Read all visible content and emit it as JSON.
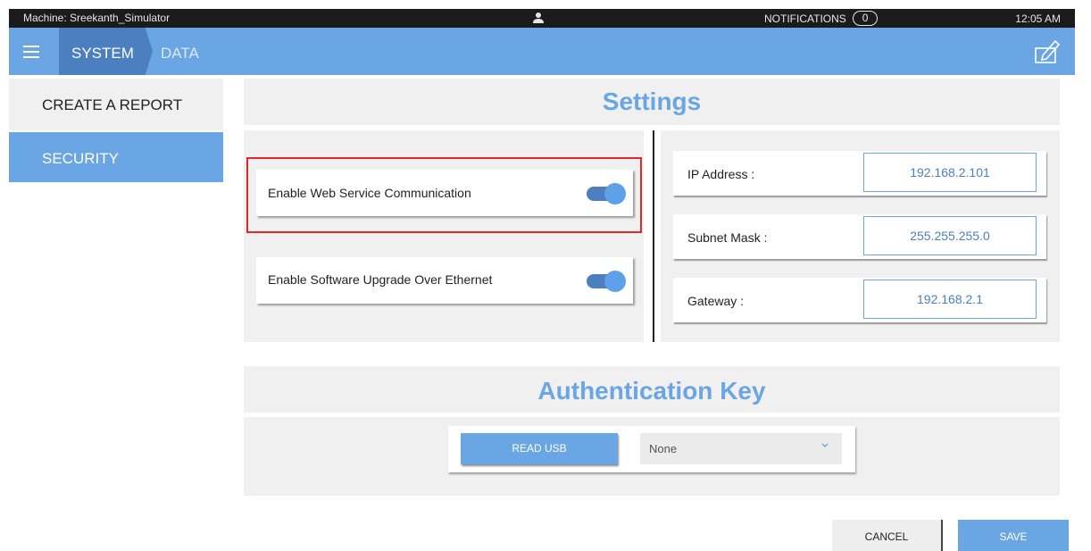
{
  "status_bar": {
    "machine": "Machine: Sreekanth_Simulator",
    "notifications_label": "NOTIFICATIONS",
    "notifications_count": "0",
    "time": "12:05 AM",
    "user_icon": "user-icon"
  },
  "nav": {
    "menu_icon": "hamburger-icon",
    "crumbs": [
      "SYSTEM",
      "DATA"
    ],
    "edit_icon": "edit-icon",
    "accent_color": "#6aa6e3",
    "active_crumb_color": "#4b7fc0"
  },
  "sidebar": {
    "items": [
      {
        "label": "CREATE A REPORT",
        "active": false
      },
      {
        "label": "SECURITY",
        "active": true
      }
    ]
  },
  "settings": {
    "title": "Settings",
    "toggles": [
      {
        "label": "Enable Web Service Communication",
        "on": true,
        "highlighted": true
      },
      {
        "label": "Enable Software Upgrade Over Ethernet",
        "on": true,
        "highlighted": false
      }
    ],
    "network": [
      {
        "label": "IP Address :",
        "value": "192.168.2.101"
      },
      {
        "label": "Subnet Mask :",
        "value": "255.255.255.0"
      },
      {
        "label": "Gateway :",
        "value": "192.168.2.1"
      }
    ],
    "highlight_color": "#e0282b"
  },
  "auth": {
    "title": "Authentication Key",
    "read_usb_label": "READ USB",
    "selected": "None"
  },
  "footer": {
    "cancel_label": "CANCEL",
    "save_label": "SAVE"
  }
}
